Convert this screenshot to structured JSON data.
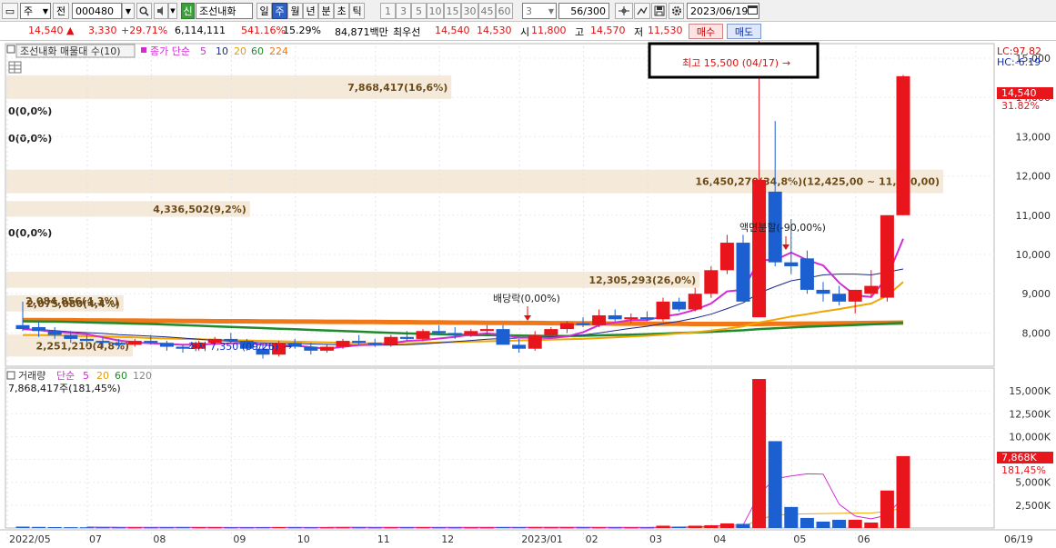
{
  "toolbar": {
    "type_select": "주",
    "prev_label": "전",
    "code": "000480",
    "badge": "신",
    "stock_name": "조선내화",
    "periods": [
      "일",
      "주",
      "월",
      "년",
      "분",
      "초",
      "틱"
    ],
    "minutes": [
      "1",
      "3",
      "5",
      "10",
      "15",
      "30",
      "45",
      "60"
    ],
    "count_select": "3",
    "range_value": "56/300",
    "date": "2023/06/19"
  },
  "quote": {
    "price": "14,540",
    "change": "3,330",
    "change_pct": "+29.71%",
    "volume": "6,114,111",
    "vol_ratio": "541.16%",
    "turnover": "15.29%",
    "amount": "84,871백만",
    "ask_label": "최우선",
    "ask": "14,540",
    "bid": "14,530",
    "open_label": "시",
    "open": "11,800",
    "high_label": "고",
    "high": "14,570",
    "low_label": "저",
    "low": "11,530",
    "buy_label": "매수",
    "sell_label": "매도"
  },
  "colors": {
    "up": "#e8151c",
    "down": "#1c5fd0",
    "ma5": "#d42bd4",
    "ma10": "#1a2a8a",
    "ma20": "#f0a500",
    "ma60": "#1e8a2e",
    "ma224": "#f07818",
    "band": "#f5ead9"
  },
  "price_panel": {
    "legend_name": "조선내화 매물대 수(10)",
    "ma_label": "종가 단순",
    "ma_periods": [
      "5",
      "10",
      "20",
      "60",
      "224"
    ],
    "lc": "LC:97.82",
    "hc": "HC:-6.19",
    "current_price_tag": "14,540",
    "current_pct_tag": "31.82%",
    "y_ticks": [
      {
        "v": 8000,
        "label": "8,000"
      },
      {
        "v": 9000,
        "label": "9,000"
      },
      {
        "v": 10000,
        "label": "10,000"
      },
      {
        "v": 11000,
        "label": "11,000"
      },
      {
        "v": 12000,
        "label": "12,000"
      },
      {
        "v": 13000,
        "label": "13,000"
      },
      {
        "v": 14000,
        "label": "14,000"
      },
      {
        "v": 15000,
        "label": "15,000"
      }
    ],
    "volume_profile": [
      {
        "pmin": 7400,
        "pmax": 7960,
        "label": "2,251,210(4,8%)",
        "frac": 0.135
      },
      {
        "pmin": 8550,
        "pmax": 8960,
        "label": "2,075,080(4,4%)",
        "frac": 0.125
      },
      {
        "pmin": 9150,
        "pmax": 9560,
        "label": "12,305,293(26,0%)",
        "frac": 0.74
      },
      {
        "pmin": 10360,
        "pmax": 10760,
        "label": "0(0,0%)",
        "frac": 0
      },
      {
        "pmin": 10960,
        "pmax": 11360,
        "label": "4,336,502(9,2%)",
        "frac": 0.26
      },
      {
        "pmin": 11560,
        "pmax": 12160,
        "label": "16,450,270(34,8%)(12,425,00 ~ 11,720,00)",
        "frac": 1
      },
      {
        "pmin": 12760,
        "pmax": 13160,
        "label": "0(0,0%)",
        "frac": 0
      },
      {
        "pmin": 13460,
        "pmax": 13860,
        "label": "0(0,0%)",
        "frac": 0
      },
      {
        "pmin": 13960,
        "pmax": 14560,
        "label": "7,868,417(16,6%)",
        "frac": 0.475
      }
    ],
    "overlap_label": "2,084,856(4,3%)",
    "annotations": {
      "dividend": "배당락(0,00%)",
      "split": "액면분할(-90,00%)",
      "high": "최고 15,500 (04/17)",
      "low": "최저 7,350 (09/26)"
    }
  },
  "volume_panel": {
    "legend_name": "거래량",
    "ma_label": "단순",
    "ma_periods": [
      "5",
      "20",
      "60",
      "120"
    ],
    "info": "7,868,417주(181,45%)",
    "last_tag": "7,868K",
    "last_pct_tag": "181,45%",
    "y_ticks": [
      {
        "v": 2500,
        "label": "2,500K"
      },
      {
        "v": 5000,
        "label": "5,000K"
      },
      {
        "v": 7500,
        "label": "7,500K"
      },
      {
        "v": 10000,
        "label": "10,000K"
      },
      {
        "v": 12500,
        "label": "12,500K"
      },
      {
        "v": 15000,
        "label": "15,000K"
      }
    ]
  },
  "x_axis": [
    {
      "i": 0,
      "label": "2022/05"
    },
    {
      "i": 5,
      "label": "07"
    },
    {
      "i": 9,
      "label": "08"
    },
    {
      "i": 14,
      "label": "09"
    },
    {
      "i": 18,
      "label": "10"
    },
    {
      "i": 23,
      "label": "11"
    },
    {
      "i": 27,
      "label": "12"
    },
    {
      "i": 32,
      "label": "2023/01"
    },
    {
      "i": 36,
      "label": "02"
    },
    {
      "i": 40,
      "label": "03"
    },
    {
      "i": 44,
      "label": "04"
    },
    {
      "i": 49,
      "label": "05"
    },
    {
      "i": 53,
      "label": "06"
    }
  ],
  "x_end_label": "06/19",
  "chart_data": {
    "type": "candlestick",
    "x_unit": "week",
    "y_unit": "KRW",
    "ylim": [
      7200,
      15300
    ],
    "ohlc": [
      [
        8200,
        8800,
        8050,
        8100
      ],
      [
        8150,
        8300,
        7900,
        8050
      ],
      [
        8050,
        8150,
        7850,
        7950
      ],
      [
        7950,
        8050,
        7750,
        7850
      ],
      [
        7850,
        7950,
        7700,
        7800
      ],
      [
        7800,
        7900,
        7650,
        7750
      ],
      [
        7750,
        7850,
        7600,
        7700
      ],
      [
        7700,
        7850,
        7650,
        7800
      ],
      [
        7800,
        7950,
        7700,
        7750
      ],
      [
        7750,
        7800,
        7550,
        7650
      ],
      [
        7650,
        7700,
        7500,
        7600
      ],
      [
        7600,
        7800,
        7550,
        7750
      ],
      [
        7750,
        7900,
        7700,
        7850
      ],
      [
        7850,
        8000,
        7750,
        7800
      ],
      [
        7800,
        7850,
        7550,
        7600
      ],
      [
        7600,
        7700,
        7350,
        7450
      ],
      [
        7450,
        7800,
        7400,
        7750
      ],
      [
        7750,
        7850,
        7600,
        7650
      ],
      [
        7650,
        7750,
        7450,
        7550
      ],
      [
        7550,
        7700,
        7500,
        7650
      ],
      [
        7650,
        7850,
        7600,
        7800
      ],
      [
        7800,
        7950,
        7700,
        7750
      ],
      [
        7750,
        7850,
        7650,
        7700
      ],
      [
        7700,
        7950,
        7650,
        7900
      ],
      [
        7900,
        8050,
        7800,
        7850
      ],
      [
        7850,
        8100,
        7800,
        8050
      ],
      [
        8050,
        8200,
        7950,
        8000
      ],
      [
        8000,
        8150,
        7850,
        7950
      ],
      [
        7950,
        8100,
        7900,
        8050
      ],
      [
        8050,
        8200,
        7950,
        8100
      ],
      [
        8100,
        8200,
        7850,
        7700
      ],
      [
        7700,
        7850,
        7500,
        7600
      ],
      [
        7600,
        8050,
        7550,
        7950
      ],
      [
        7950,
        8150,
        7900,
        8100
      ],
      [
        8100,
        8300,
        8000,
        8250
      ],
      [
        8250,
        8400,
        8150,
        8200
      ],
      [
        8200,
        8600,
        8150,
        8450
      ],
      [
        8450,
        8600,
        8300,
        8350
      ],
      [
        8350,
        8500,
        8250,
        8400
      ],
      [
        8400,
        8550,
        8300,
        8350
      ],
      [
        8350,
        8900,
        8300,
        8800
      ],
      [
        8800,
        8900,
        8550,
        8600
      ],
      [
        8600,
        9150,
        8550,
        9000
      ],
      [
        9000,
        9700,
        8900,
        9600
      ],
      [
        9600,
        10500,
        9500,
        10300
      ],
      [
        10300,
        10500,
        8800,
        8800
      ],
      [
        8400,
        15500,
        8400,
        11900
      ],
      [
        11600,
        13400,
        9700,
        9800
      ],
      [
        9800,
        10900,
        9500,
        9700
      ],
      [
        9900,
        10100,
        9000,
        9100
      ],
      [
        9100,
        9300,
        8800,
        9000
      ],
      [
        9000,
        9200,
        8700,
        8800
      ],
      [
        8800,
        9100,
        8500,
        9100
      ],
      [
        9000,
        9600,
        8900,
        9200
      ],
      [
        8900,
        11000,
        8800,
        11000
      ],
      [
        11000,
        14570,
        11000,
        14540
      ]
    ],
    "volume_k": [
      150,
      120,
      100,
      90,
      80,
      70,
      65,
      60,
      60,
      70,
      80,
      70,
      65,
      60,
      60,
      70,
      90,
      70,
      60,
      60,
      65,
      60,
      55,
      60,
      65,
      70,
      60,
      55,
      50,
      55,
      90,
      80,
      70,
      60,
      65,
      60,
      60,
      55,
      50,
      50,
      250,
      150,
      250,
      300,
      500,
      450,
      16300,
      9500,
      2300,
      1100,
      700,
      900,
      900,
      600,
      4100,
      7868
    ],
    "ma5": [
      8100,
      8075,
      8033,
      8000,
      7970,
      7890,
      7810,
      7760,
      7740,
      7720,
      7700,
      7710,
      7720,
      7740,
      7740,
      7700,
      7690,
      7680,
      7640,
      7600,
      7650,
      7690,
      7700,
      7740,
      7800,
      7820,
      7860,
      7900,
      7960,
      7990,
      7960,
      7880,
      7880,
      7870,
      7910,
      8020,
      8200,
      8270,
      8330,
      8330,
      8420,
      8480,
      8590,
      8750,
      9060,
      9100,
      9860,
      9860,
      10050,
      9860,
      9720,
      9280,
      8960,
      8920,
      9420,
      10400
    ],
    "ma10": [
      8100,
      8090,
      8060,
      8030,
      8010,
      7990,
      7960,
      7940,
      7920,
      7900,
      7870,
      7840,
      7810,
      7790,
      7770,
      7750,
      7740,
      7740,
      7720,
      7710,
      7700,
      7690,
      7690,
      7690,
      7700,
      7720,
      7750,
      7780,
      7810,
      7840,
      7860,
      7870,
      7880,
      7900,
      7920,
      7950,
      8000,
      8060,
      8120,
      8170,
      8240,
      8300,
      8380,
      8480,
      8620,
      8770,
      9020,
      9180,
      9330,
      9400,
      9480,
      9500,
      9500,
      9480,
      9550,
      9630
    ],
    "ma20": [
      7950,
      7950,
      7940,
      7930,
      7920,
      7910,
      7900,
      7890,
      7870,
      7860,
      7850,
      7840,
      7830,
      7820,
      7810,
      7800,
      7790,
      7780,
      7770,
      7760,
      7750,
      7740,
      7740,
      7740,
      7740,
      7750,
      7760,
      7770,
      7780,
      7790,
      7800,
      7810,
      7820,
      7830,
      7840,
      7850,
      7870,
      7890,
      7910,
      7930,
      7960,
      7990,
      8020,
      8060,
      8110,
      8170,
      8270,
      8340,
      8420,
      8480,
      8550,
      8610,
      8680,
      8750,
      8950,
      9300
    ],
    "ma60": [
      8300,
      8295,
      8290,
      8280,
      8270,
      8260,
      8250,
      8240,
      8230,
      8215,
      8200,
      8185,
      8170,
      8155,
      8140,
      8125,
      8110,
      8095,
      8080,
      8065,
      8050,
      8035,
      8020,
      8005,
      7990,
      7980,
      7970,
      7960,
      7950,
      7945,
      7940,
      7935,
      7930,
      7925,
      7925,
      7930,
      7940,
      7950,
      7960,
      7970,
      7985,
      8000,
      8015,
      8030,
      8050,
      8070,
      8100,
      8120,
      8140,
      8160,
      8175,
      8190,
      8205,
      8220,
      8240,
      8260
    ],
    "ma224": [
      8330,
      8330,
      8325,
      8325,
      8320,
      8320,
      8315,
      8315,
      8310,
      8310,
      8305,
      8305,
      8300,
      8300,
      8300,
      8295,
      8295,
      8290,
      8290,
      8285,
      8285,
      8280,
      8280,
      8275,
      8275,
      8270,
      8270,
      8265,
      8265,
      8260,
      8260,
      8255,
      8255,
      8250,
      8250,
      8245,
      8245,
      8240,
      8240,
      8235,
      8235,
      8235,
      8230,
      8230,
      8230,
      8230,
      8230,
      8235,
      8235,
      8240,
      8240,
      8245,
      8250,
      8255,
      8260,
      8265
    ],
    "vol_ma5_k": [
      null,
      null,
      null,
      null,
      108,
      92,
      81,
      73,
      69,
      65,
      65,
      66,
      66,
      64,
      62,
      61,
      64,
      66,
      63,
      62,
      65,
      66,
      62,
      60,
      60,
      62,
      60,
      58,
      56,
      56,
      61,
      63,
      66,
      68,
      72,
      68,
      64,
      61,
      60,
      58,
      90,
      100,
      130,
      200,
      290,
      330,
      3700,
      5400,
      5700,
      5930,
      5900,
      2600,
      1300,
      1000,
      1400,
      3400
    ],
    "vol_ma20_k": [
      null,
      null,
      null,
      null,
      null,
      null,
      null,
      null,
      null,
      null,
      null,
      null,
      null,
      null,
      null,
      null,
      null,
      null,
      null,
      84,
      82,
      80,
      78,
      75,
      74,
      73,
      72,
      70,
      69,
      68,
      68,
      68,
      68,
      68,
      68,
      68,
      67,
      66,
      65,
      64,
      74,
      78,
      87,
      98,
      120,
      140,
      950,
      1400,
      1500,
      1550,
      1580,
      1600,
      1630,
      1640,
      1820,
      2200
    ]
  }
}
